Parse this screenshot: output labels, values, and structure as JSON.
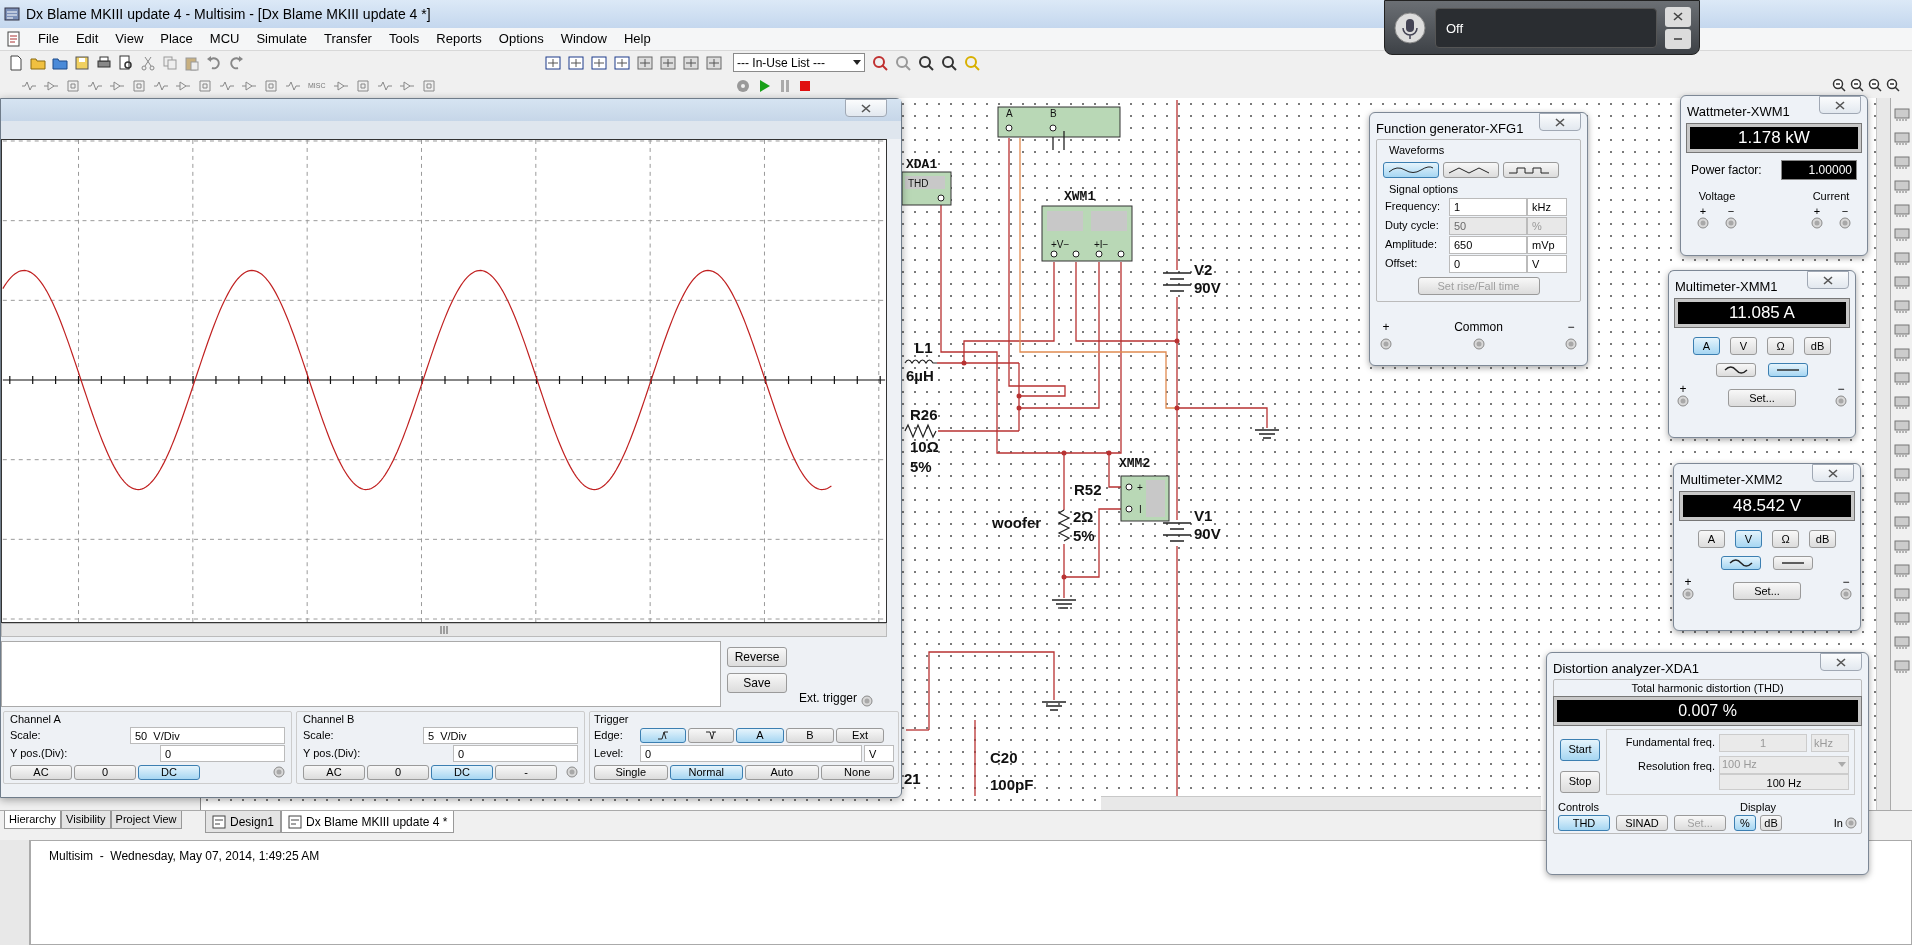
{
  "window": {
    "title": "Dx Blame MKIII update 4 - Multisim - [Dx Blame MKIII update 4 *]"
  },
  "menu": [
    "File",
    "Edit",
    "View",
    "Place",
    "MCU",
    "Simulate",
    "Transfer",
    "Tools",
    "Reports",
    "Options",
    "Window",
    "Help"
  ],
  "toolbar": {
    "in_use_list": "--- In-Use List ---",
    "misc_label": "MISC"
  },
  "voice_widget": {
    "status": "Off"
  },
  "oscilloscope": {
    "buttons": [
      "Reverse",
      "Save"
    ],
    "ext_trigger": "Ext. trigger",
    "channels": [
      {
        "title": "Channel A",
        "scale_label": "Scale:",
        "scale": "50  V/Div",
        "ypos_label": "Y pos.(Div):",
        "ypos": "0",
        "coupling": [
          {
            "label": "AC",
            "selected": false
          },
          {
            "label": "0",
            "selected": false
          },
          {
            "label": "DC",
            "selected": true
          }
        ]
      },
      {
        "title": "Channel B",
        "scale_label": "Scale:",
        "scale": "5  V/Div",
        "ypos_label": "Y pos.(Div):",
        "ypos": "0",
        "coupling": [
          {
            "label": "AC",
            "selected": false
          },
          {
            "label": "0",
            "selected": false
          },
          {
            "label": "DC",
            "selected": true
          },
          {
            "label": "-",
            "selected": false
          }
        ]
      }
    ],
    "trigger": {
      "title": "Trigger",
      "edge_label": "Edge:",
      "edges": [
        {
          "kind": "rising",
          "selected": true
        },
        {
          "kind": "falling",
          "selected": false
        }
      ],
      "sources": [
        {
          "label": "A",
          "selected": true
        },
        {
          "label": "B",
          "selected": false
        },
        {
          "label": "Ext",
          "selected": false
        }
      ],
      "level_label": "Level:",
      "level": "0",
      "level_unit": "V",
      "modes": [
        {
          "label": "Single",
          "selected": false
        },
        {
          "label": "Normal",
          "selected": true
        },
        {
          "label": "Auto",
          "selected": false
        },
        {
          "label": "None",
          "selected": false
        }
      ]
    }
  },
  "circuit": {
    "labels": [
      {
        "text": "XDA1",
        "kind": "ref"
      },
      {
        "text": "THD",
        "kind": "pin"
      },
      {
        "text": "A",
        "kind": "pin"
      },
      {
        "text": "B",
        "kind": "pin"
      },
      {
        "text": "XWM1",
        "kind": "ref"
      },
      {
        "text": "+V−",
        "kind": "pin"
      },
      {
        "text": "+I−",
        "kind": "pin"
      },
      {
        "text": "V2",
        "kind": "value"
      },
      {
        "text": "90V",
        "kind": "value"
      },
      {
        "text": "L1",
        "kind": "value"
      },
      {
        "text": "6µH",
        "kind": "value"
      },
      {
        "text": "R26",
        "kind": "value"
      },
      {
        "text": "10Ω",
        "kind": "value"
      },
      {
        "text": "5%",
        "kind": "value"
      },
      {
        "text": "R52",
        "kind": "value"
      },
      {
        "text": "woofer",
        "kind": "value"
      },
      {
        "text": "2Ω",
        "kind": "value"
      },
      {
        "text": "5%",
        "kind": "value"
      },
      {
        "text": "XMM2",
        "kind": "ref"
      },
      {
        "text": "+",
        "kind": "pin"
      },
      {
        "text": "I",
        "kind": "pin"
      },
      {
        "text": "V1",
        "kind": "value"
      },
      {
        "text": "90V",
        "kind": "value"
      },
      {
        "text": "C20",
        "kind": "value"
      },
      {
        "text": "100pF",
        "kind": "value"
      },
      {
        "text": "21",
        "kind": "value"
      }
    ]
  },
  "function_generator": {
    "title": "Function generator-XFG1",
    "waveforms_label": "Waveforms",
    "waveforms": [
      {
        "kind": "sine",
        "selected": true
      },
      {
        "kind": "triangle",
        "selected": false
      },
      {
        "kind": "square",
        "selected": false
      }
    ],
    "signal_options_label": "Signal options",
    "fields": [
      {
        "label": "Frequency:",
        "value": "1",
        "unit": "kHz",
        "disabled": false
      },
      {
        "label": "Duty cycle:",
        "value": "50",
        "unit": "%",
        "disabled": true
      },
      {
        "label": "Amplitude:",
        "value": "650",
        "unit": "mVp",
        "disabled": false
      },
      {
        "label": "Offset:",
        "value": "0",
        "unit": "V",
        "disabled": false
      }
    ],
    "rise_fall_button": "Set rise/Fall time",
    "terminals": [
      "+",
      "Common",
      "−"
    ]
  },
  "wattmeter": {
    "title": "Wattmeter-XWM1",
    "reading": "1.178 kW",
    "power_factor_label": "Power factor:",
    "power_factor": "1.00000",
    "groups": [
      {
        "label": "Voltage",
        "terminals": [
          "+",
          "−"
        ]
      },
      {
        "label": "Current",
        "terminals": [
          "+",
          "−"
        ]
      }
    ]
  },
  "multimeters": [
    {
      "title": "Multimeter-XMM1",
      "reading": "11.085 A",
      "modes": [
        {
          "label": "A",
          "selected": true
        },
        {
          "label": "V",
          "selected": false
        },
        {
          "label": "Ω",
          "selected": false
        },
        {
          "label": "dB",
          "selected": false
        }
      ],
      "signal": [
        {
          "kind": "ac",
          "selected": false
        },
        {
          "kind": "dc",
          "selected": true
        }
      ],
      "set_button": "Set...",
      "terminals": [
        "+",
        "−"
      ]
    },
    {
      "title": "Multimeter-XMM2",
      "reading": "48.542 V",
      "modes": [
        {
          "label": "A",
          "selected": false
        },
        {
          "label": "V",
          "selected": true
        },
        {
          "label": "Ω",
          "selected": false
        },
        {
          "label": "dB",
          "selected": false
        }
      ],
      "signal": [
        {
          "kind": "ac",
          "selected": true
        },
        {
          "kind": "dc",
          "selected": false
        }
      ],
      "set_button": "Set...",
      "terminals": [
        "+",
        "−"
      ]
    }
  ],
  "distortion_analyzer": {
    "title": "Distortion analyzer-XDA1",
    "heading": "Total harmonic distortion (THD)",
    "reading": "0.007 %",
    "run_buttons": [
      {
        "label": "Start",
        "selected": true
      },
      {
        "label": "Stop",
        "selected": false
      }
    ],
    "fundamental_label": "Fundamental freq.",
    "fundamental": "1",
    "fundamental_unit": "kHz",
    "resolution_label": "Resolution freq.",
    "resolution": "100 Hz",
    "resolution_value": "100 Hz",
    "controls_label": "Controls",
    "controls": [
      {
        "label": "THD",
        "selected": true,
        "disabled": false
      },
      {
        "label": "SINAD",
        "selected": false,
        "disabled": false
      },
      {
        "label": "Set...",
        "selected": false,
        "disabled": true
      }
    ],
    "display_label": "Display",
    "display": [
      {
        "label": "%",
        "selected": true
      },
      {
        "label": "dB",
        "selected": false
      }
    ],
    "input_label": "In"
  },
  "panel_tabs": [
    {
      "label": "Hierarchy",
      "selected": true
    },
    {
      "label": "Visibility",
      "selected": false
    },
    {
      "label": "Project View",
      "selected": false
    }
  ],
  "design_tabs": [
    {
      "label": "Design1",
      "selected": false
    },
    {
      "label": "Dx Blame MKIII update 4 *",
      "selected": true
    }
  ],
  "log": [
    "Multisim  -  Wednesday, May 07, 2014, 1:49:25 AM"
  ]
}
